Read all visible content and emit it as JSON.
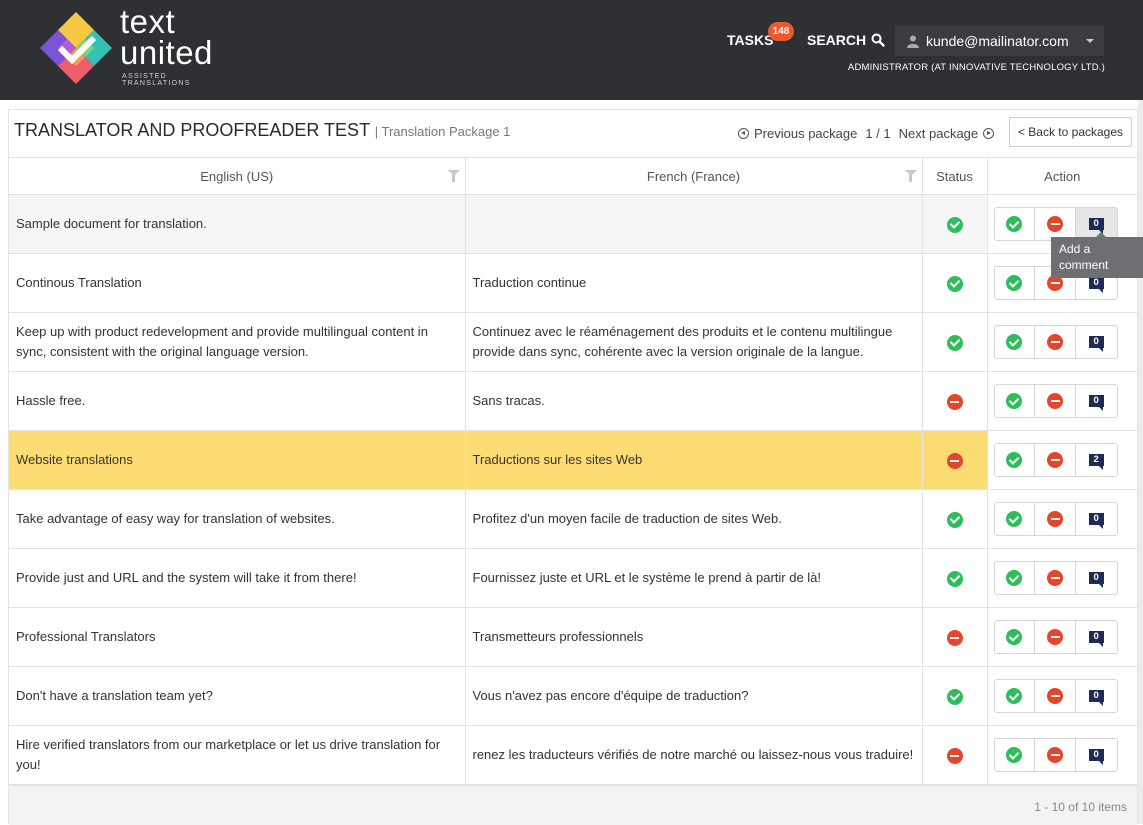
{
  "brand": {
    "logo_line1": "text",
    "logo_line2": "united",
    "tagline": "ASSISTED TRANSLATIONS"
  },
  "header": {
    "tasks_label": "TASKS",
    "tasks_count": "148",
    "search_label": "SEARCH",
    "user_email": "kunde@mailinator.com",
    "user_role": "ADMINISTRATOR (AT INNOVATIVE TECHNOLOGY LTD.)"
  },
  "page": {
    "title": "TRANSLATOR AND PROOFREADER TEST",
    "subtitle": "| Translation Package 1",
    "prev_label": "Previous package",
    "page_indicator": "1 / 1",
    "next_label": "Next package",
    "back_label": "< Back to packages"
  },
  "table": {
    "columns": [
      "English (US)",
      "French (France)",
      "Status",
      "Action"
    ],
    "rows": [
      {
        "source": "Sample document for translation.",
        "target": "",
        "status": "ok",
        "comments": "0"
      },
      {
        "source": "Continous Translation",
        "target": "Traduction continue",
        "status": "ok",
        "comments": "0"
      },
      {
        "source": "Keep up with product redevelopment and provide multilingual content in sync, consistent with the original language version.",
        "target": "Continuez avec le réaménagement des produits et le contenu multilingue provide dans sync, cohérente avec la version originale de la langue.",
        "status": "ok",
        "comments": "0"
      },
      {
        "source": "Hassle free.",
        "target": "Sans tracas.",
        "status": "rejected",
        "comments": "0"
      },
      {
        "source": "Website translations",
        "target": "Traductions sur les sites Web",
        "status": "rejected",
        "comments": "2"
      },
      {
        "source": "Take advantage of easy way for translation of websites.",
        "target": "Profitez d'un moyen facile de traduction de sites Web.",
        "status": "ok",
        "comments": "0"
      },
      {
        "source": "Provide just and URL and the system will take it from there!",
        "target": "Fournissez juste et URL et le système le prend à partir de là!",
        "status": "ok",
        "comments": "0"
      },
      {
        "source": "Professional Translators",
        "target": "Transmetteurs professionnels",
        "status": "rejected",
        "comments": "0"
      },
      {
        "source": "Don't have a translation team yet?",
        "target": "Vous n'avez pas encore d'équipe de traduction?",
        "status": "ok",
        "comments": "0"
      },
      {
        "source": "Hire verified translators from our marketplace or let us drive translation for you!",
        "target": "renez les traducteurs vérifiés de notre marché ou laissez-nous vous traduire!",
        "status": "rejected",
        "comments": "0"
      }
    ]
  },
  "tooltip": {
    "text": "Add a comment"
  },
  "footer": {
    "info": "1 - 10 of 10 items"
  },
  "colors": {
    "header_bg": "#2f3033",
    "highlight_row": "#fddc74",
    "ok": "#2dbd5a",
    "rejected": "#e5452a",
    "badge": "#e95a2e"
  }
}
